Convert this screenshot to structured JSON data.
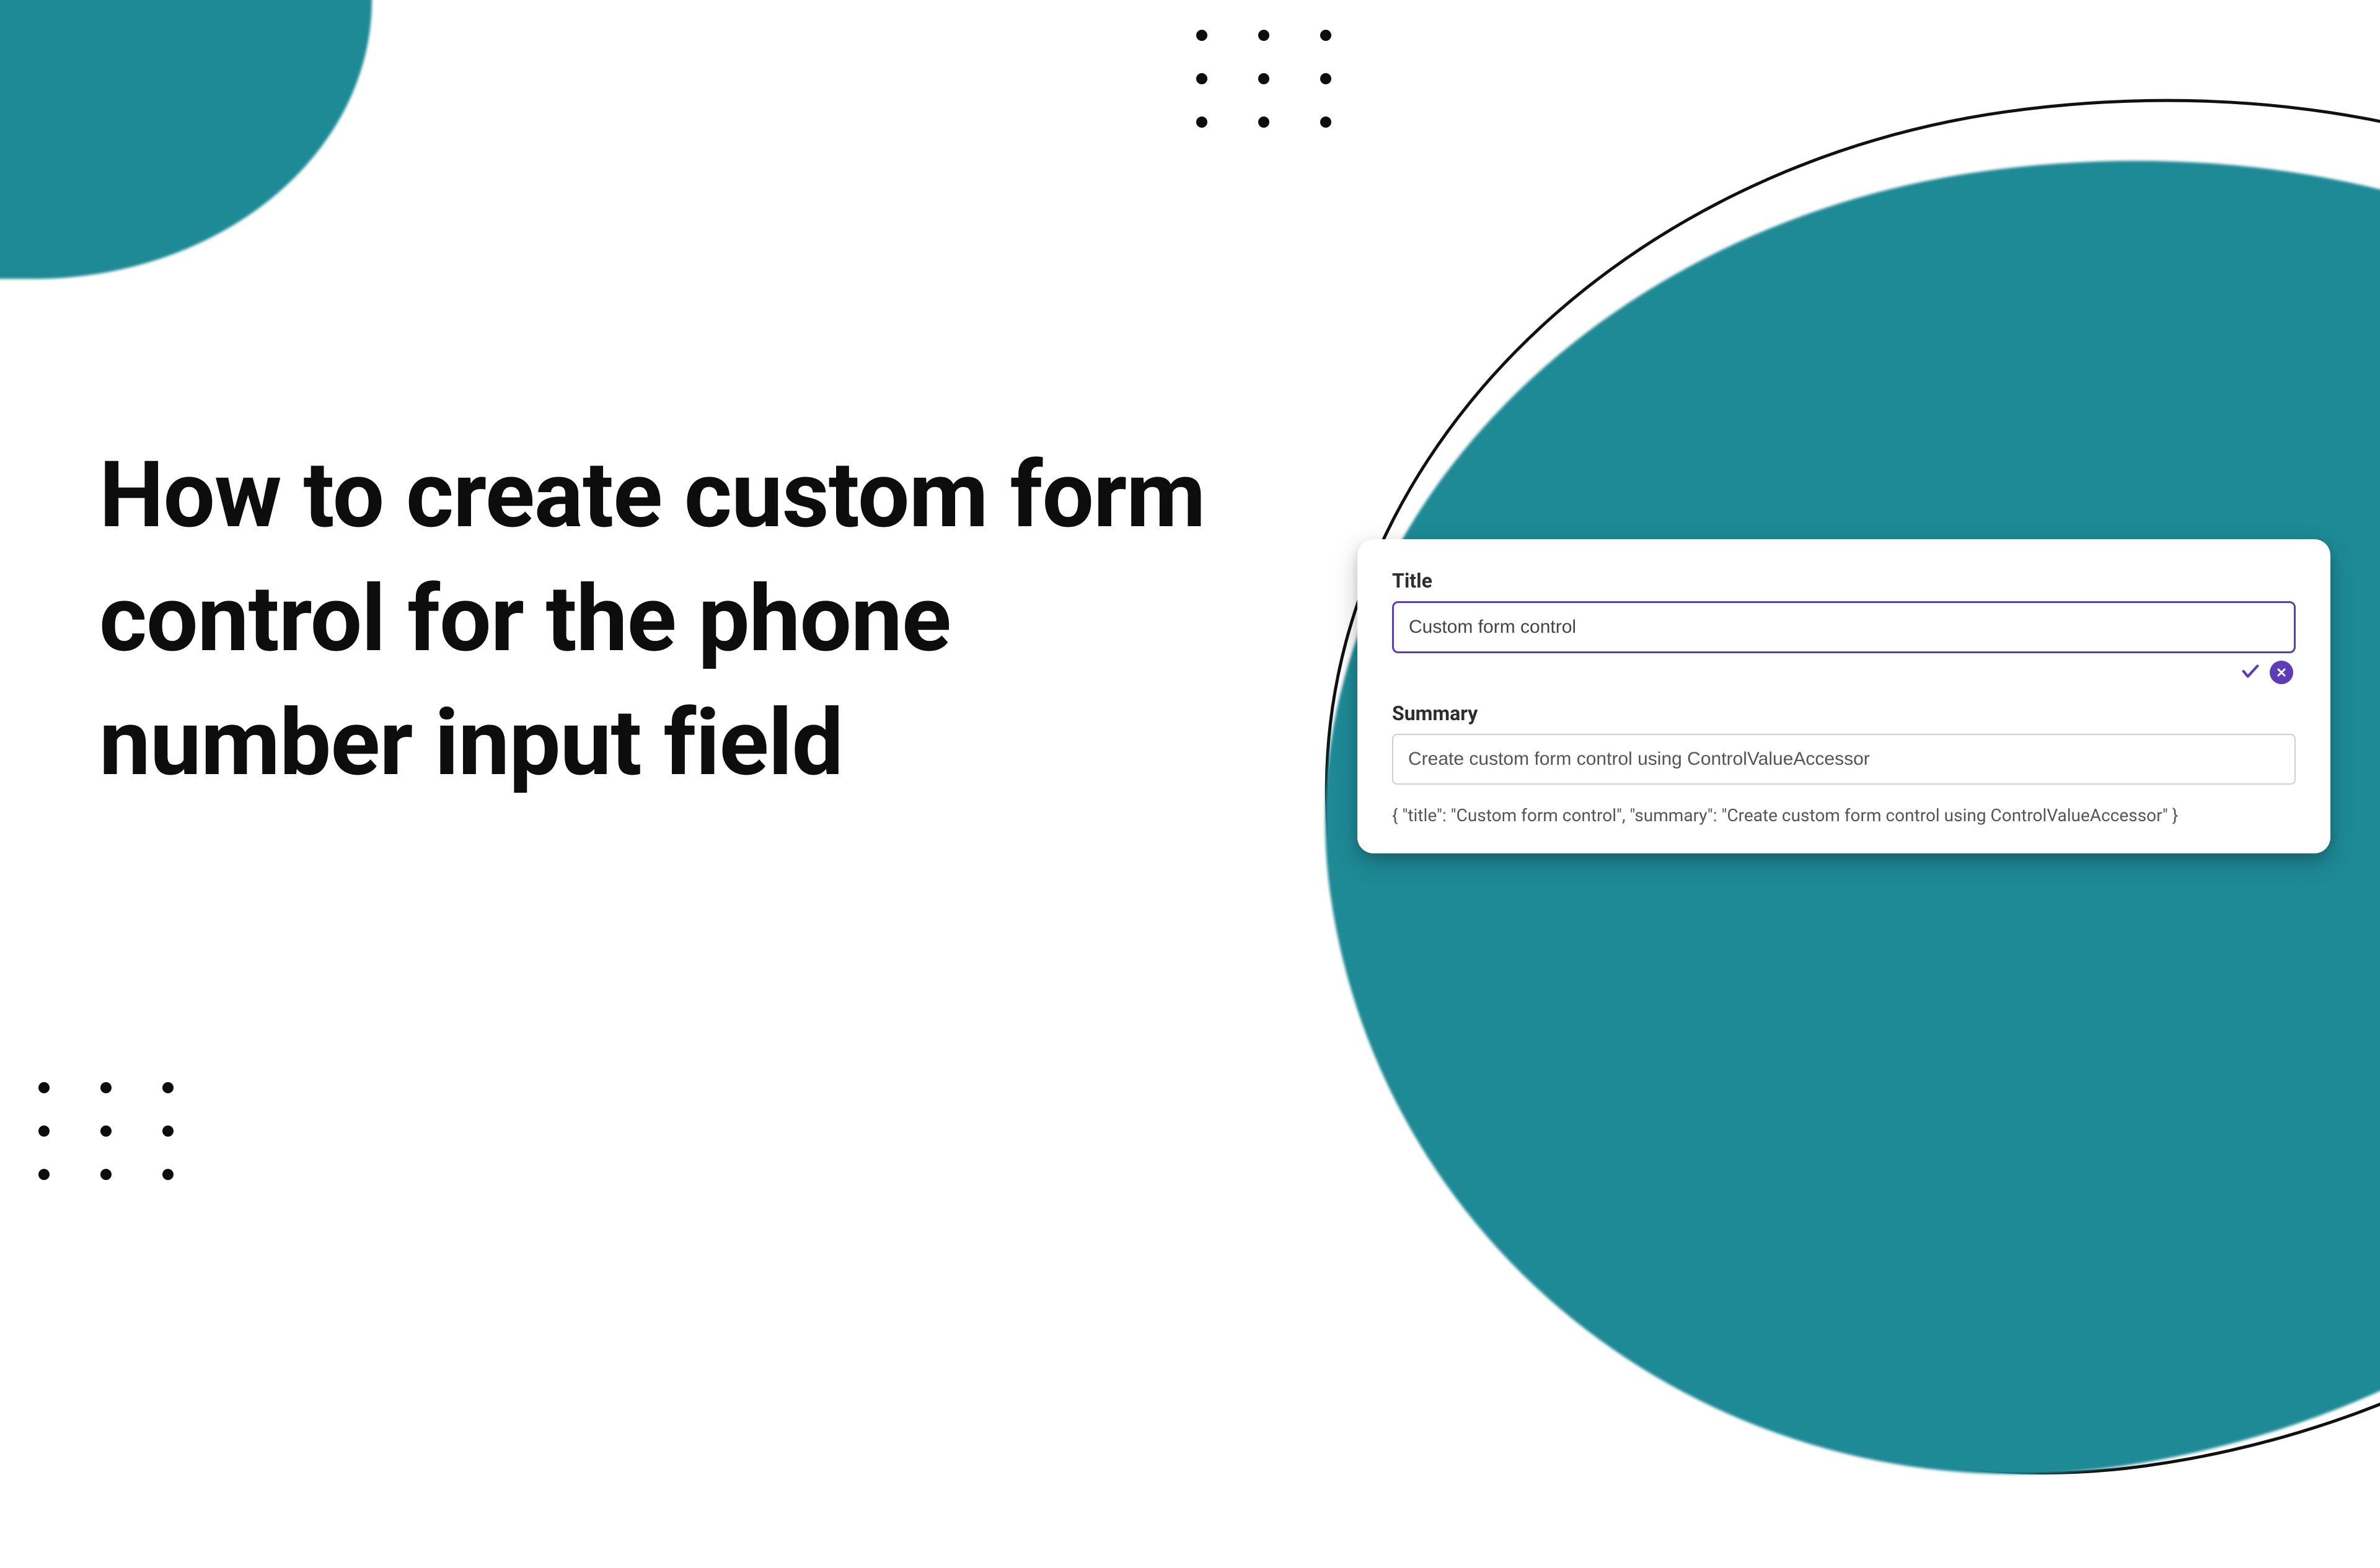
{
  "colors": {
    "teal": "#1e8a96",
    "accent": "#5d3db5"
  },
  "headline": "How to create custom form control for the phone number input field",
  "card": {
    "fields": {
      "title": {
        "label": "Title",
        "value": "Custom form control"
      },
      "summary": {
        "label": "Summary",
        "value": "Create custom form control using ControlValueAccessor"
      }
    },
    "actions": {
      "confirm_label": "✓",
      "cancel_label": "✕"
    },
    "json_output": "{ \"title\": \"Custom form control\", \"summary\": \"Create custom form control using ControlValueAccessor\" }"
  }
}
